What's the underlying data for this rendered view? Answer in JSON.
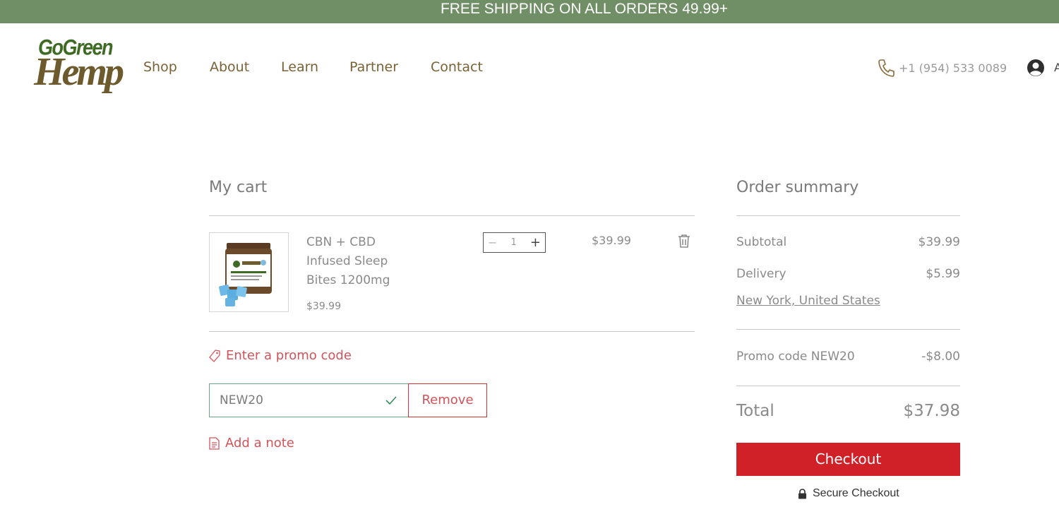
{
  "banner": {
    "text": "FREE SHIPPING ON ALL ORDERS 49.99+"
  },
  "brand": {
    "logo_top": "GoGreen",
    "logo_bottom": "Hemp"
  },
  "nav": {
    "items": [
      "Shop",
      "About",
      "Learn",
      "Partner",
      "Contact"
    ]
  },
  "header": {
    "phone": "+1 (954) 533 0089",
    "account_label_cut": "A"
  },
  "cart": {
    "title": "My cart",
    "item": {
      "name": "CBN + CBD Infused Sleep Bites 1200mg",
      "unit_price": "$39.99",
      "quantity": "1",
      "line_total": "$39.99",
      "minus": "−",
      "plus": "+"
    },
    "promo_link": "Enter a promo code",
    "promo_value": "NEW20",
    "remove_label": "Remove",
    "note_link": "Add a note"
  },
  "summary": {
    "title": "Order summary",
    "subtotal_label": "Subtotal",
    "subtotal_value": "$39.99",
    "delivery_label": "Delivery",
    "delivery_value": "$5.99",
    "location": "New York, United States",
    "promo_label": "Promo code NEW20",
    "promo_value": "-$8.00",
    "total_label": "Total",
    "total_value": "$37.98",
    "checkout_label": "Checkout",
    "secure_label": "Secure Checkout"
  },
  "colors": {
    "banner_bg": "#718f66",
    "nav_text": "#7a6236",
    "accent_red": "#d02028",
    "promo_border": "#6aa587"
  }
}
